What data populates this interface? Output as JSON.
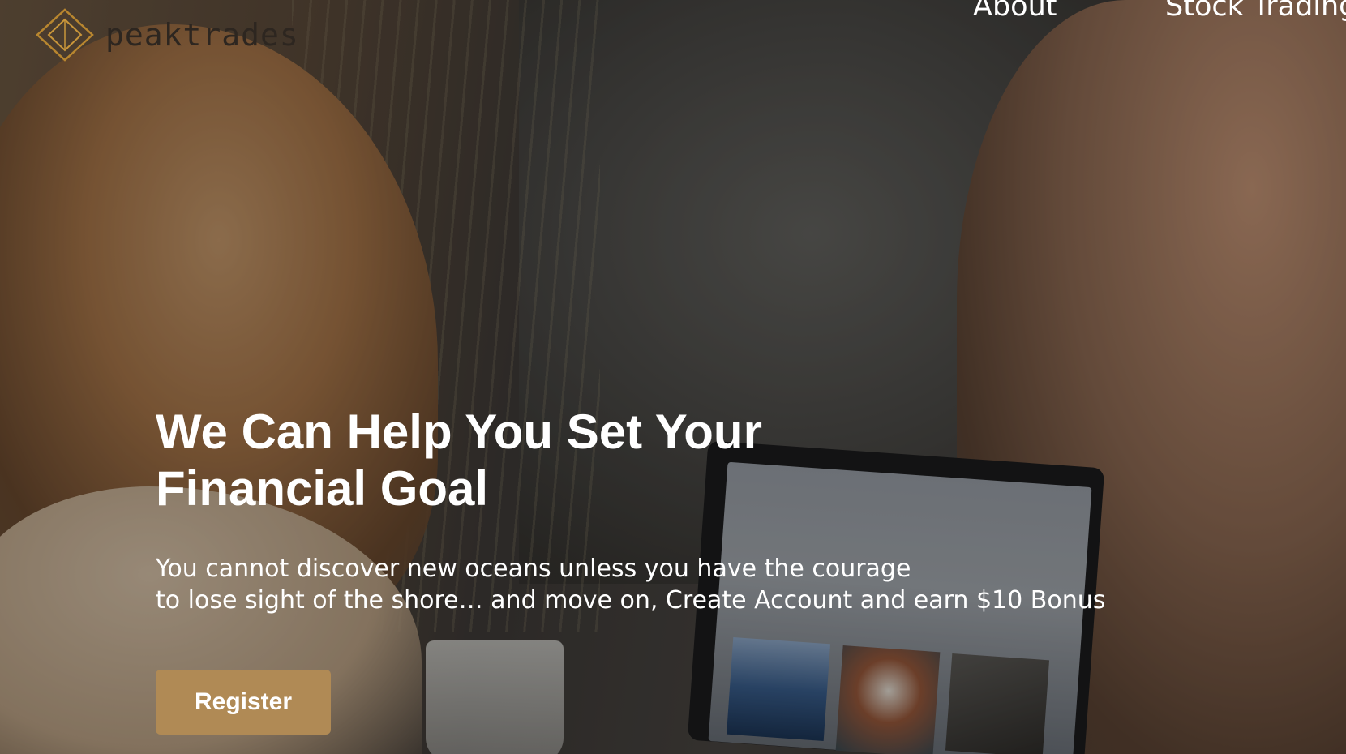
{
  "brand": {
    "name": "peaktrades",
    "logo_icon": "diamond-logo-icon",
    "logo_color": "#b8862f"
  },
  "nav": {
    "items": [
      {
        "label": "About"
      },
      {
        "label": "Stock Trading"
      }
    ]
  },
  "hero": {
    "headline": "We Can Help You Set Your Financial Goal",
    "subtext_line1": "You cannot discover new oceans unless you have the courage",
    "subtext_line2": "to lose sight of the shore… and move on, Create Account and earn $10 Bonus",
    "cta_label": "Register",
    "cta_color": "#b08a55",
    "text_color": "#ffffff"
  }
}
